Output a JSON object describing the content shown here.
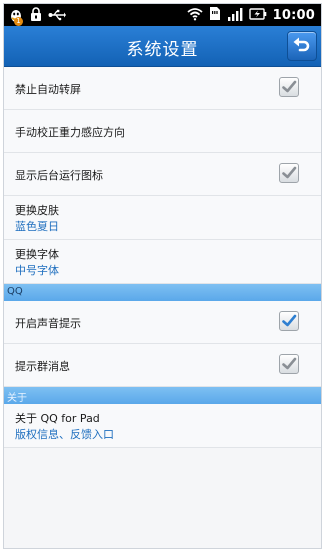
{
  "status_bar": {
    "time": "10:00",
    "notification_count": "1"
  },
  "header": {
    "title": "系统设置"
  },
  "settings": [
    {
      "label": "禁止自动转屏",
      "checked": true
    },
    {
      "label": "手动校正重力感应方向"
    },
    {
      "label": "显示后台运行图标",
      "checked": true
    },
    {
      "label": "更换皮肤",
      "value": "蓝色夏日"
    },
    {
      "label": "更换字体",
      "value": "中号字体"
    }
  ],
  "sections": {
    "qq": "QQ",
    "about": "关于"
  },
  "qq_settings": [
    {
      "label": "开启声音提示",
      "checked": true,
      "accent": "#2e7fd1"
    },
    {
      "label": "提示群消息",
      "checked": true
    }
  ],
  "about": {
    "label": "关于 QQ for Pad",
    "value": "版权信息、反馈入口"
  },
  "colors": {
    "title_bar": "#1a6fc4",
    "section_bar": "#6bb3ee",
    "value_text": "#1f6fbf"
  }
}
